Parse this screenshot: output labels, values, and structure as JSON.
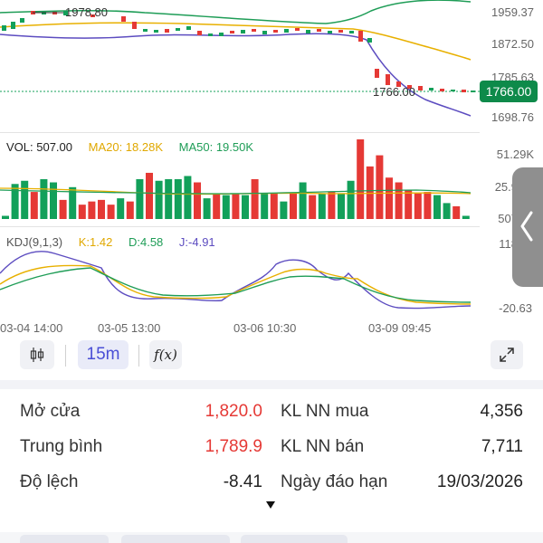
{
  "main": {
    "y_labels": [
      "1959.37",
      "1872.50",
      "1785.63",
      "1698.76"
    ],
    "high_label": "1978.80",
    "low_label": "1766.00",
    "last_price": "1766.00",
    "colors": {
      "up": "#12a05a",
      "down": "#e53935",
      "ma_short": "#5c4cc0",
      "ma_mid": "#e8b000",
      "boll": "#1f9d57"
    }
  },
  "volume": {
    "vol_label": "VOL: 507.00",
    "ma20_label": "MA20: 18.28K",
    "ma50_label": "MA50: 19.50K",
    "y_labels": [
      "51.29K",
      "25.9",
      "507"
    ]
  },
  "kdj": {
    "title": "KDJ(9,1,3)",
    "k_label": "K:1.42",
    "d_label": "D:4.58",
    "j_label": "J:-4.91",
    "y_labels": [
      "118",
      "-20.63"
    ]
  },
  "time_axis": [
    "03-04 14:00",
    "03-05 13:00",
    "03-06 10:30",
    "03-09 09:45"
  ],
  "toolbar": {
    "candle_icon": "candlestick-icon",
    "interval": "15m",
    "fx_label": "f(x)",
    "expand_icon": "expand-icon"
  },
  "side_handle_icon": "chevron-left-icon",
  "info": {
    "open_label": "Mở cửa",
    "open_value": "1,820.0",
    "avg_label": "Trung bình",
    "avg_value": "1,789.9",
    "dev_label": "Độ lệch",
    "dev_value": "-8.41",
    "buy_label": "KL NN mua",
    "buy_value": "4,356",
    "sell_label": "KL NN bán",
    "sell_value": "7,711",
    "expiry_label": "Ngày đáo hạn",
    "expiry_value": "19/03/2026"
  },
  "more_icon": "caret-down-icon",
  "chart_data": [
    {
      "type": "candlestick",
      "y_range": [
        1698.76,
        1978.8
      ],
      "series": [
        {
          "name": "VOL",
          "values": [
            2,
            22,
            24,
            17,
            25,
            23,
            12,
            20,
            9,
            11,
            12,
            9,
            13,
            11,
            25,
            29,
            24,
            25,
            25,
            27,
            23,
            13,
            16,
            15,
            16,
            15,
            25,
            16,
            16,
            11,
            16,
            23,
            15,
            16,
            17,
            16,
            24,
            50,
            33,
            40,
            26,
            23,
            18,
            16,
            17,
            15,
            10,
            8,
            2
          ]
        }
      ]
    }
  ]
}
